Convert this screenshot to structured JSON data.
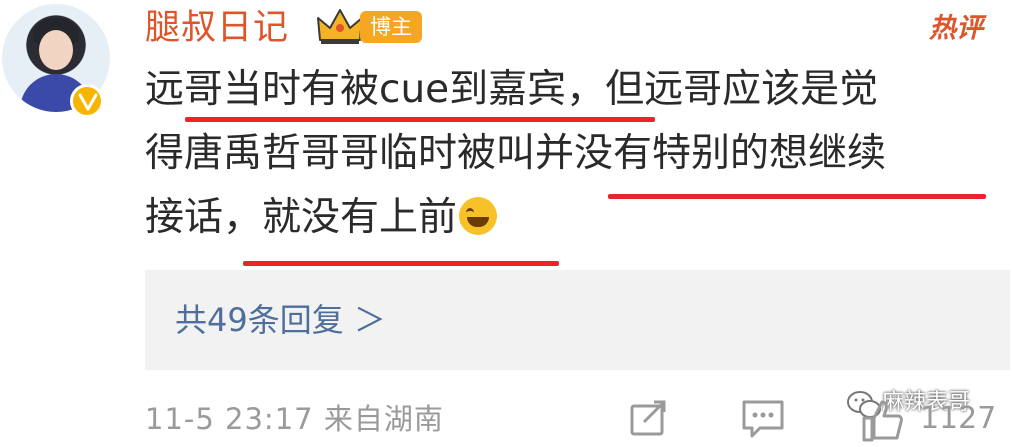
{
  "comment": {
    "username": "腿叔日记",
    "badge_label": "博主",
    "hot_label": "热评",
    "text_lines": [
      "远哥当时有被cue到嘉宾，但远哥应该是觉",
      "得唐禹哲哥哥临时被叫并没有特别的想继续",
      "接话，就没有上前"
    ],
    "reply_link": "共49条回复 ＞",
    "timestamp": "11-5 23:17",
    "location": "来自湖南",
    "like_count": "1127"
  },
  "watermark": {
    "text": "麻辣表哥"
  },
  "colors": {
    "username": "#e0542a",
    "badge": "#f6a623",
    "underline": "#e8252a",
    "reply_link": "#4e6f9b",
    "meta": "#9a9a9a"
  },
  "icons": [
    "avatar",
    "verified-badge-icon",
    "crown-icon",
    "laugh-cry-emoji-icon",
    "chevron-right-icon",
    "share-icon",
    "comment-icon",
    "wechat-icon",
    "like-icon"
  ]
}
